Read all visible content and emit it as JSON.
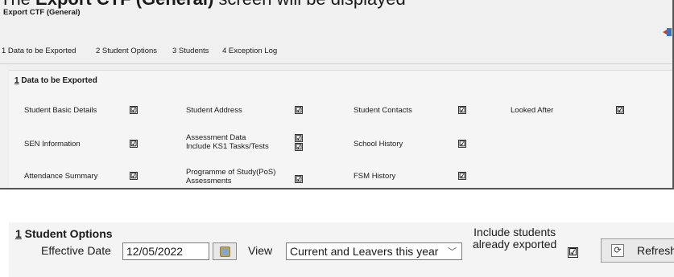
{
  "caption": {
    "prefix": "The ",
    "bold": "Export CTF (General)",
    "suffix": " screen will be displayed"
  },
  "window": {
    "title": "Export CTF (General)",
    "exit_icon": "exit-door-icon"
  },
  "tabs": [
    {
      "label": "1 Data to be Exported"
    },
    {
      "label": "2 Student Options"
    },
    {
      "label": "3 Students"
    },
    {
      "label": "4 Exception Log"
    }
  ],
  "data_panel": {
    "heading_number": "1",
    "heading_text": " Data to be Exported",
    "items": [
      {
        "label": "Student Basic Details",
        "checked": true
      },
      {
        "label": "Student Address",
        "checked": true
      },
      {
        "label": "Student Contacts",
        "checked": true
      },
      {
        "label": "Looked After",
        "checked": true
      },
      {
        "label": "SEN Information",
        "checked": true
      },
      {
        "label": "Assessment Data",
        "checked": true
      },
      {
        "label": "Include KS1 Tasks/Tests",
        "checked": true
      },
      {
        "label": "School History",
        "checked": true
      },
      {
        "label": "Attendance Summary",
        "checked": true
      },
      {
        "label": "Programme of Study(PoS)",
        "label2": "Assessments",
        "checked": true
      },
      {
        "label": "FSM History",
        "checked": true
      }
    ],
    "check_glyph": "☑"
  },
  "student_options": {
    "heading_number": "1",
    "heading_text": " Student Options",
    "effective_date_label": "Effective Date",
    "effective_date_value": "12/05/2022",
    "view_label": "View",
    "view_value": "Current and Leavers this year",
    "include_label_1": "Include students",
    "include_label_2": "already exported",
    "include_checked": true,
    "refresh_label": "Refresh"
  }
}
